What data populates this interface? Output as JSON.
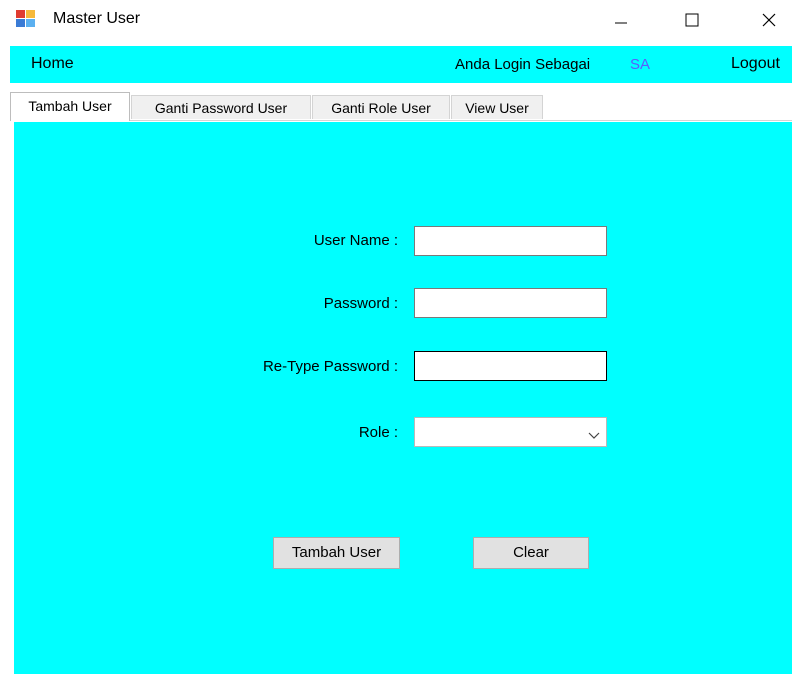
{
  "window": {
    "title": "Master User",
    "icons": {
      "app": "app-form-icon",
      "minimize": "minimize-icon",
      "maximize": "maximize-icon",
      "close": "close-icon"
    }
  },
  "menu": {
    "home": "Home",
    "login_label": "Anda Login Sebagai",
    "login_user": "SA",
    "logout": "Logout"
  },
  "tabs": [
    {
      "label": "Tambah User",
      "active": true
    },
    {
      "label": "Ganti Password User",
      "active": false
    },
    {
      "label": "Ganti Role User",
      "active": false
    },
    {
      "label": "View User",
      "active": false
    }
  ],
  "form": {
    "username_label": "User Name :",
    "username_value": "",
    "password_label": "Password :",
    "password_value": "",
    "retype_label": "Re-Type Password :",
    "retype_value": "",
    "role_label": "Role :",
    "role_value": "",
    "submit_label": "Tambah User",
    "clear_label": "Clear"
  },
  "colors": {
    "background": "#00ffff",
    "login_user": "#5b5bff",
    "button_face": "#e1e1e1"
  }
}
